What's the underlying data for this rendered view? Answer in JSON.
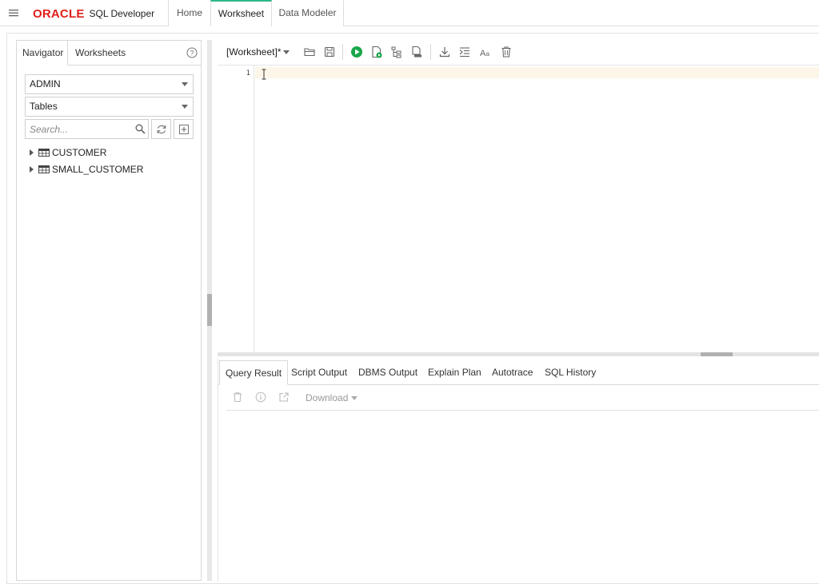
{
  "header": {
    "brand_oracle": "ORACLE",
    "brand_product": "SQL Developer",
    "tabs": [
      {
        "label": "Home"
      },
      {
        "label": "Worksheet"
      },
      {
        "label": "Data Modeler"
      }
    ],
    "active_tab_color": "#2eb88a"
  },
  "navigator": {
    "tabs": [
      {
        "label": "Navigator"
      },
      {
        "label": "Worksheets"
      }
    ],
    "schema": "ADMIN",
    "object_type": "Tables",
    "search_placeholder": "Search...",
    "tree": [
      {
        "label": "CUSTOMER",
        "icon": "table-icon"
      },
      {
        "label": "SMALL_CUSTOMER",
        "icon": "table-icon"
      }
    ]
  },
  "worksheet": {
    "name": "[Worksheet]*",
    "toolbar_icons": [
      "open-folder-icon",
      "save-icon",
      "run-statement-icon",
      "run-script-icon",
      "explain-plan-icon",
      "autotrace-icon",
      "download-icon",
      "format-icon",
      "text-case-icon",
      "clear-icon"
    ],
    "line_numbers": [
      "1"
    ],
    "run_color": "#1aa64a"
  },
  "results": {
    "tabs": [
      {
        "label": "Query Result"
      },
      {
        "label": "Script Output"
      },
      {
        "label": "DBMS Output"
      },
      {
        "label": "Explain Plan"
      },
      {
        "label": "Autotrace"
      },
      {
        "label": "SQL History"
      }
    ],
    "toolbar_icons": [
      "delete-icon",
      "info-icon",
      "open-external-icon"
    ],
    "download_label": "Download"
  },
  "colors": {
    "brand_red": "#e0201b",
    "current_line": "#fdf6e8"
  }
}
